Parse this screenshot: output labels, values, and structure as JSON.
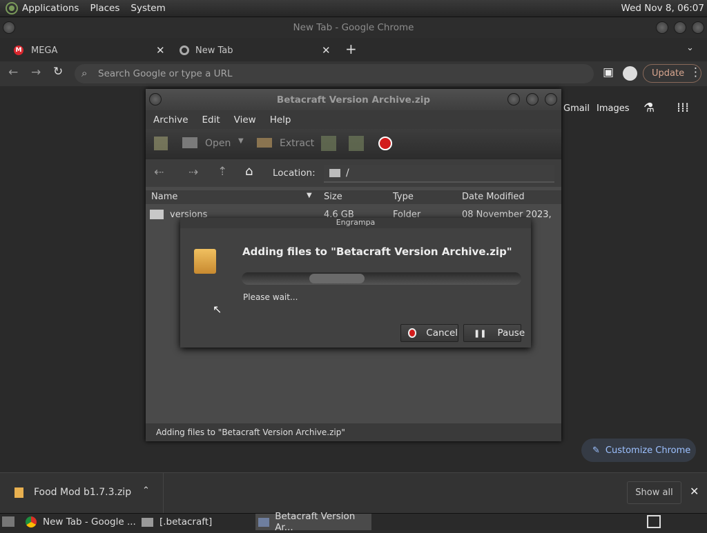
{
  "top_panel": {
    "menus": [
      "Applications",
      "Places",
      "System"
    ],
    "clock": "Wed Nov  8, 06:07"
  },
  "chrome": {
    "window_title": "New Tab - Google Chrome",
    "tabs": [
      {
        "label": "MEGA",
        "icon": "mega-icon"
      },
      {
        "label": "New Tab",
        "icon": "chrome-icon"
      }
    ],
    "omnibox_placeholder": "Search Google or type a URL",
    "update_label": "Update",
    "ntp_links": [
      "Gmail",
      "Images"
    ],
    "customize_label": "Customize Chrome"
  },
  "engrampa": {
    "title": "Betacraft Version Archive.zip",
    "menus": [
      "Archive",
      "Edit",
      "View",
      "Help"
    ],
    "toolbar": {
      "open_label": "Open",
      "extract_label": "Extract"
    },
    "location_label": "Location:",
    "location_value": "/",
    "columns": [
      "Name",
      "Size",
      "Type",
      "Date Modified"
    ],
    "rows": [
      {
        "name": "versions",
        "size": "4.6 GB",
        "type": "Folder",
        "date": "08 November 2023, ..."
      }
    ],
    "status": "Adding files to \"Betacraft Version Archive.zip\""
  },
  "dialog": {
    "title": "Engrampa",
    "heading": "Adding files to \"Betacraft Version Archive.zip\"",
    "wait_text": "Please wait...",
    "cancel_label": "Cancel",
    "pause_label": "Pause"
  },
  "downloads": {
    "file": "Food Mod b1.7.3.zip",
    "show_all_label": "Show all"
  },
  "taskbar": {
    "tasks": [
      "New Tab - Google ...",
      "[.betacraft]",
      "Betacraft Version Ar..."
    ]
  }
}
